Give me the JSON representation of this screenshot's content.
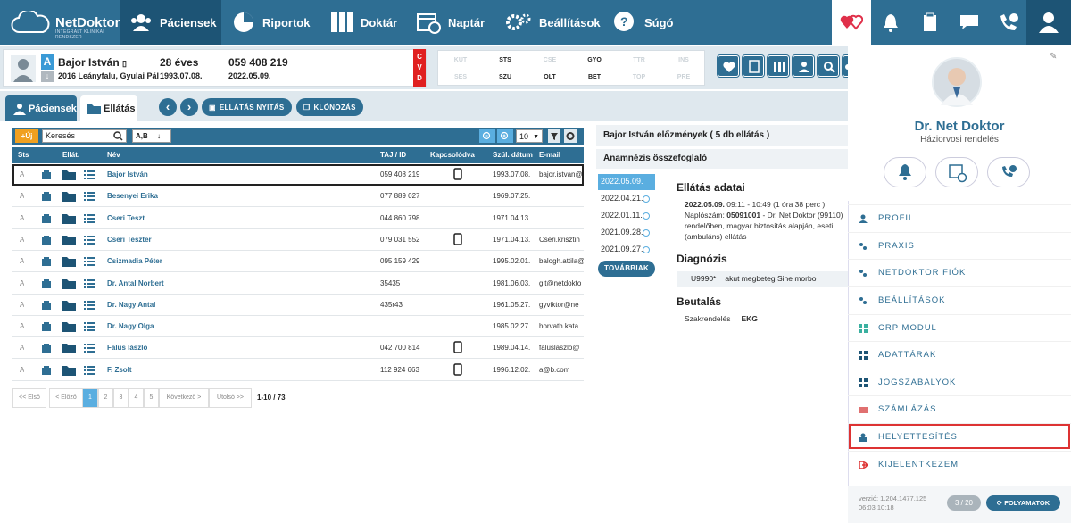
{
  "brand": {
    "name": "NetDoktor",
    "tagline": "INTEGRÁLT KLINIKAI RENDSZER"
  },
  "nav": [
    {
      "label": "Páciensek",
      "icon": "users-icon"
    },
    {
      "label": "Riportok",
      "icon": "pie-chart-icon"
    },
    {
      "label": "Doktár",
      "icon": "binders-icon"
    },
    {
      "label": "Naptár",
      "icon": "calendar-icon"
    },
    {
      "label": "Beállítások",
      "icon": "gears-icon"
    },
    {
      "label": "Súgó",
      "icon": "help-icon"
    }
  ],
  "patient": {
    "name": "Bajor István",
    "address": "2016 Leányfalu, Gyulai Pál",
    "age": "28 éves",
    "dob": "1993.07.08.",
    "taj": "059 408 219",
    "visit_date": "2022.05.09.",
    "letter": "A",
    "cvd": "CVD"
  },
  "days": [
    "KUT",
    "STS",
    "CSE",
    "GYO",
    "TTR",
    "INS",
    "SES",
    "SZU",
    "OLT",
    "BET",
    "TOP",
    "PRE"
  ],
  "tabs": {
    "patients": "Páciensek",
    "care": "Ellátás",
    "open_care": "ELLÁTÁS NYITÁS",
    "clone": "KLÓNOZÁS"
  },
  "toolbar": {
    "new": "+Új",
    "search_placeholder": "Keresés",
    "sort": "A,B",
    "page_size": "10"
  },
  "table": {
    "headers": [
      "Sts",
      "Ellát.",
      "Név",
      "TAJ / ID",
      "Kapcsolódva",
      "Szül. dátum",
      "E-mail"
    ],
    "rows": [
      {
        "sts": "A",
        "name": "Bajor István",
        "taj": "059 408 219",
        "phone": true,
        "dob": "1993.07.08.",
        "email": "bajor.istvan@"
      },
      {
        "sts": "A",
        "name": "Besenyei Erika",
        "taj": "077 889 027",
        "phone": false,
        "dob": "1969.07.25.",
        "email": ""
      },
      {
        "sts": "A",
        "name": "Cseri Teszt",
        "taj": "044 860 798",
        "phone": false,
        "dob": "1971.04.13.",
        "email": ""
      },
      {
        "sts": "A",
        "name": "Cseri Teszter",
        "taj": "079 031 552",
        "phone": true,
        "dob": "1971.04.13.",
        "email": "Cseri.krisztin"
      },
      {
        "sts": "A",
        "name": "Csizmadia Péter",
        "taj": "095 159 429",
        "phone": false,
        "dob": "1995.02.01.",
        "email": "balogh.attila@"
      },
      {
        "sts": "A",
        "name": "Dr. Antal Norbert",
        "taj": "35435",
        "phone": false,
        "dob": "1981.06.03.",
        "email": "git@netdokto"
      },
      {
        "sts": "A",
        "name": "Dr. Nagy Antal",
        "taj": "435r43",
        "phone": false,
        "dob": "1961.05.27.",
        "email": "gyviktor@ne"
      },
      {
        "sts": "A",
        "name": "Dr. Nagy Olga",
        "taj": "",
        "phone": false,
        "dob": "1985.02.27.",
        "email": "horvath.kata"
      },
      {
        "sts": "A",
        "name": "Falus lászló",
        "taj": "042 700 814",
        "phone": true,
        "dob": "1989.04.14.",
        "email": "faluslaszlo@"
      },
      {
        "sts": "A",
        "name": "F. Zsolt",
        "taj": "112 924 663",
        "phone": true,
        "dob": "1996.12.02.",
        "email": "a@b.com"
      }
    ]
  },
  "pager": {
    "first": "<< Első",
    "prev": "< Előző",
    "pages": [
      "1",
      "2",
      "3",
      "4",
      "5"
    ],
    "next": "Következő >",
    "last": "Utolsó >>",
    "count": "1-10 / 73"
  },
  "history": {
    "title": "Bajor István előzmények ( 5 db ellátás )",
    "anamnesis": "Anamnézis összefoglaló",
    "dates": [
      "2022.05.09.",
      "2022.04.21.",
      "2022.01.11.",
      "2021.09.28.",
      "2021.09.27."
    ],
    "more": "TOVÁBBIAK"
  },
  "care": {
    "title": "Ellátás adatai",
    "line1": "2022.05.09.",
    "line1b": " 09:11 - 10:49 (1 óra 38 perc )",
    "line2a": "Naplószám: ",
    "line2b": "05091001",
    "line2c": " - Dr. Net Doktor (99110)",
    "line3": "rendelőben, magyar biztosítás alapján, eseti",
    "line4": "(ambuláns) ellátás",
    "diag_title": "Diagnózis",
    "diag_code": "U9990*",
    "diag_text": "akut megbeteg  Sine morbo",
    "ref_title": "Beutalás",
    "ref_type": "Szakrendelés",
    "ref_value": "EKG"
  },
  "profile": {
    "name": "Dr. Net Doktor",
    "role": "Háziorvosi rendelés"
  },
  "menu": [
    "PROFIL",
    "PRAXIS",
    "NETDOKTOR FIÓK",
    "BEÁLLÍTÁSOK",
    "CRP MODUL",
    "ADATTÁRAK",
    "JOGSZABÁLYOK",
    "SZÁMLÁZÁS",
    "HELYETTESÍTÉS",
    "KIJELENTKEZEM"
  ],
  "footer": {
    "version": "verzió: 1.204.1477.125",
    "time": "06:03 10:18",
    "counter": "3 / 20",
    "processes": "FOLYAMATOK"
  },
  "colors": {
    "primary": "#2e6e93",
    "accent": "#5aaee0",
    "cvd": "#e02020",
    "highlight": "#dd3333"
  }
}
